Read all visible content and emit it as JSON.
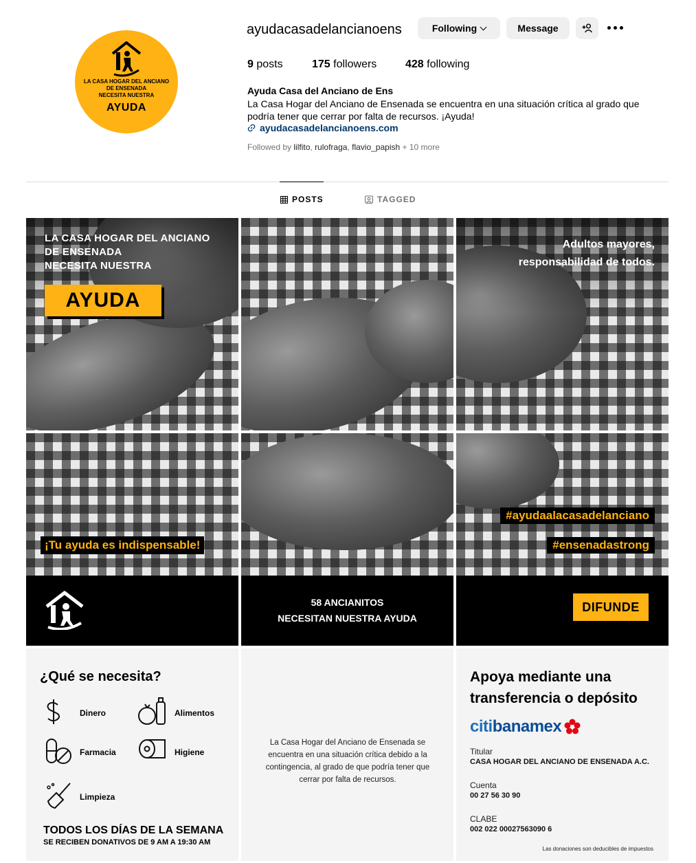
{
  "profile": {
    "username": "ayudacasadelancianoens",
    "avatar": {
      "line1": "LA CASA HOGAR DEL ANCIANO",
      "line2": "DE ENSENADA",
      "line3": "NECESITA NUESTRA",
      "big": "AYUDA",
      "color": "#FEB213"
    },
    "buttons": {
      "following": "Following",
      "message": "Message"
    },
    "stats": {
      "posts_count": "9",
      "posts_label": "posts",
      "followers_count": "175",
      "followers_label": "followers",
      "following_count": "428",
      "following_label": "following"
    },
    "full_name": "Ayuda Casa del Anciano de Ens",
    "bio": "La Casa Hogar del Anciano de Ensenada se encuentra en una situación crítica al grado que podría tener que cerrar por falta de recursos. ¡Ayuda!",
    "link": "ayudacasadelancianoens.com",
    "followed_by": {
      "prefix": "Followed by",
      "names": [
        "lilfito",
        "rulofraga",
        "flavio_papish"
      ],
      "more": "+ 10 more"
    }
  },
  "tabs": {
    "posts": "POSTS",
    "tagged": "TAGGED"
  },
  "posts": {
    "p1": {
      "line1": "LA CASA HOGAR DEL ANCIANO",
      "line2": "DE ENSENADA",
      "line3": "NECESITA NUESTRA",
      "box": "AYUDA"
    },
    "p3": {
      "line1": "Adultos mayores,",
      "line2": "responsabilidad de todos."
    },
    "p4": {
      "label": "¡Tu ayuda es indispensable!"
    },
    "p5": {
      "line1": "58 ANCIANITOS",
      "line2": "NECESITAN NUESTRA AYUDA"
    },
    "p6": {
      "tag1": "#ayudaalacasadelanciano",
      "tag2": "#ensenadastrong",
      "button": "DIFUNDE"
    },
    "p7": {
      "title": "¿Qué se necesita?",
      "items": [
        {
          "label": "Dinero",
          "icon": "money-icon"
        },
        {
          "label": "Alimentos",
          "icon": "food-icon"
        },
        {
          "label": "Farmacia",
          "icon": "pills-icon"
        },
        {
          "label": "Higiene",
          "icon": "toilet-paper-icon"
        },
        {
          "label": "Limpieza",
          "icon": "broom-icon"
        }
      ],
      "footer1": "TODOS LOS DÍAS DE LA SEMANA",
      "footer2": "SE RECIBEN DONATIVOS DE 9 AM A 19:30 AM"
    },
    "p8": {
      "text": "La Casa Hogar del Anciano de Ensenada se encuentra en una situación crítica debido a la contingencia, al grado de que podría tener que cerrar por falta de recursos."
    },
    "p9": {
      "title_line1": "Apoya mediante una",
      "title_line2": "transferencia o depósito",
      "brand_a": "citi",
      "brand_b": "banamex",
      "titular_label": "Titular",
      "titular_value": "CASA HOGAR DEL ANCIANO DE ENSENADA A.C.",
      "cuenta_label": "Cuenta",
      "cuenta_value": "00 27 56 30 90",
      "clabe_label": "CLABE",
      "clabe_value": "002 022 00027563090 6",
      "note": "Las donaciones son deducibles de impuestos"
    }
  },
  "colors": {
    "accent": "#FEB213",
    "link": "#00376b",
    "button_bg": "#efefef"
  }
}
